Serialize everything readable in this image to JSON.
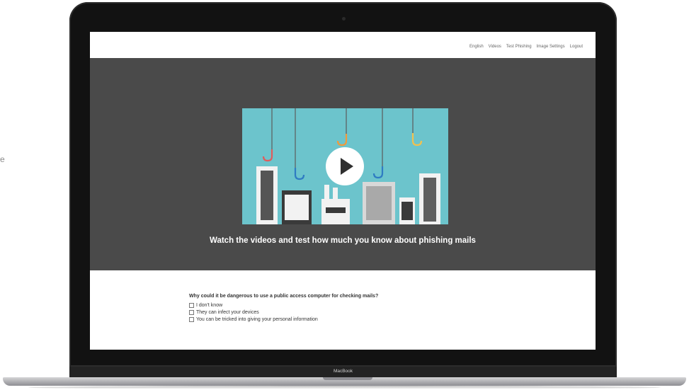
{
  "edge_text": "e",
  "nav": {
    "links": [
      "English",
      "Videos",
      "Test Phishing",
      "Image Settings",
      "Logout"
    ]
  },
  "hero": {
    "title": "Watch the videos and test how much you know about phishing mails"
  },
  "video": {
    "play_icon": "play-icon",
    "background_color": "#6cc4cc"
  },
  "quiz": {
    "question": "Why could it be dangerous to use a public access computer for checking mails?",
    "options": [
      "I don't know",
      "They can infect your devices",
      "You can be tricked into giving your personal information"
    ]
  },
  "device": {
    "brand": "MacBook"
  },
  "colors": {
    "hero_background": "#4a4a4a",
    "hook_red": "#e05c5c",
    "hook_yellow": "#f2c14e",
    "hook_orange": "#f29a3b",
    "hook_blue": "#2f7cc2"
  }
}
